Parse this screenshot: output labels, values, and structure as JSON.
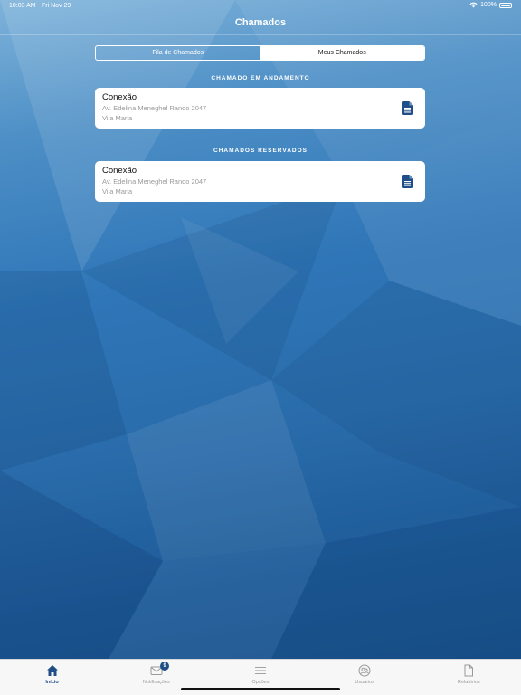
{
  "status_bar": {
    "time": "10:03 AM",
    "date": "Fri Nov 29",
    "battery": "100%",
    "icons": [
      "wifi-icon",
      "battery-icon"
    ]
  },
  "nav": {
    "title": "Chamados"
  },
  "segmented": {
    "options": [
      "Fila de Chamados",
      "Meus Chamados"
    ],
    "selected": "Meus Chamados"
  },
  "sections": [
    {
      "header": "CHAMADO EM ANDAMENTO",
      "card": {
        "title": "Conexão",
        "address": "Av. Edelina Meneghel Rando 2047",
        "district": "Vila Maria",
        "icon": "document-icon"
      }
    },
    {
      "header": "CHAMADOS RESERVADOS",
      "card": {
        "title": "Conexão",
        "address": "Av. Edelina Meneghel Rando 2047",
        "district": "Vila Maria",
        "icon": "document-icon"
      }
    }
  ],
  "tab_bar": {
    "tabs": [
      {
        "label": "Início",
        "icon": "home-icon",
        "active": true
      },
      {
        "label": "Notificações",
        "icon": "mail-icon",
        "badge": "9"
      },
      {
        "label": "Opções",
        "icon": "menu-icon"
      },
      {
        "label": "Usuários",
        "icon": "users-icon"
      },
      {
        "label": "Relatórios",
        "icon": "file-icon"
      }
    ]
  },
  "colors": {
    "accent": "#1f4f86",
    "background_light": "#7fb3da",
    "background_dark": "#184f88",
    "card": "#ffffff",
    "muted_text": "#9a9a9a"
  }
}
